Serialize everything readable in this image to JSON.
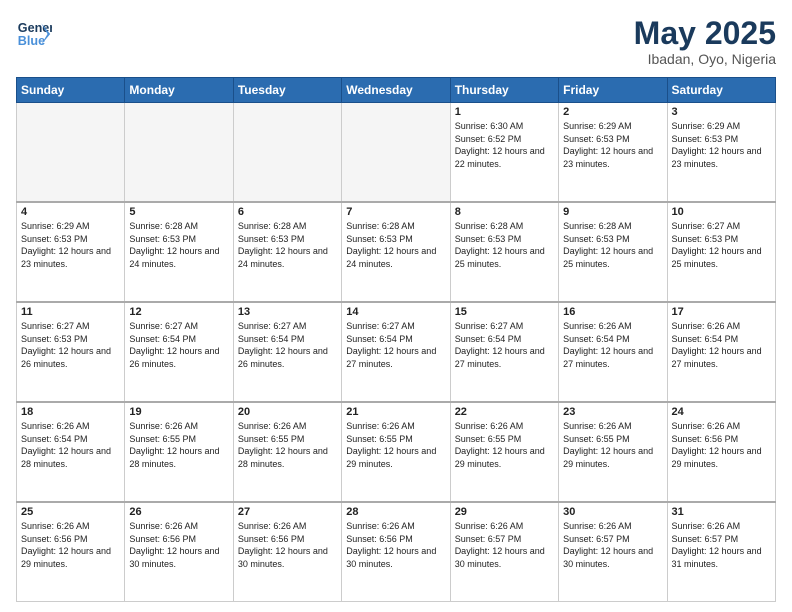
{
  "header": {
    "logo_line1": "General",
    "logo_line2": "Blue",
    "month": "May 2025",
    "location": "Ibadan, Oyo, Nigeria"
  },
  "days_of_week": [
    "Sunday",
    "Monday",
    "Tuesday",
    "Wednesday",
    "Thursday",
    "Friday",
    "Saturday"
  ],
  "weeks": [
    [
      {
        "day": "",
        "empty": true
      },
      {
        "day": "",
        "empty": true
      },
      {
        "day": "",
        "empty": true
      },
      {
        "day": "",
        "empty": true
      },
      {
        "day": "1",
        "sunrise": "6:30 AM",
        "sunset": "6:52 PM",
        "daylight": "12 hours and 22 minutes."
      },
      {
        "day": "2",
        "sunrise": "6:29 AM",
        "sunset": "6:53 PM",
        "daylight": "12 hours and 23 minutes."
      },
      {
        "day": "3",
        "sunrise": "6:29 AM",
        "sunset": "6:53 PM",
        "daylight": "12 hours and 23 minutes."
      }
    ],
    [
      {
        "day": "4",
        "sunrise": "6:29 AM",
        "sunset": "6:53 PM",
        "daylight": "12 hours and 23 minutes."
      },
      {
        "day": "5",
        "sunrise": "6:28 AM",
        "sunset": "6:53 PM",
        "daylight": "12 hours and 24 minutes."
      },
      {
        "day": "6",
        "sunrise": "6:28 AM",
        "sunset": "6:53 PM",
        "daylight": "12 hours and 24 minutes."
      },
      {
        "day": "7",
        "sunrise": "6:28 AM",
        "sunset": "6:53 PM",
        "daylight": "12 hours and 24 minutes."
      },
      {
        "day": "8",
        "sunrise": "6:28 AM",
        "sunset": "6:53 PM",
        "daylight": "12 hours and 25 minutes."
      },
      {
        "day": "9",
        "sunrise": "6:28 AM",
        "sunset": "6:53 PM",
        "daylight": "12 hours and 25 minutes."
      },
      {
        "day": "10",
        "sunrise": "6:27 AM",
        "sunset": "6:53 PM",
        "daylight": "12 hours and 25 minutes."
      }
    ],
    [
      {
        "day": "11",
        "sunrise": "6:27 AM",
        "sunset": "6:53 PM",
        "daylight": "12 hours and 26 minutes."
      },
      {
        "day": "12",
        "sunrise": "6:27 AM",
        "sunset": "6:54 PM",
        "daylight": "12 hours and 26 minutes."
      },
      {
        "day": "13",
        "sunrise": "6:27 AM",
        "sunset": "6:54 PM",
        "daylight": "12 hours and 26 minutes."
      },
      {
        "day": "14",
        "sunrise": "6:27 AM",
        "sunset": "6:54 PM",
        "daylight": "12 hours and 27 minutes."
      },
      {
        "day": "15",
        "sunrise": "6:27 AM",
        "sunset": "6:54 PM",
        "daylight": "12 hours and 27 minutes."
      },
      {
        "day": "16",
        "sunrise": "6:26 AM",
        "sunset": "6:54 PM",
        "daylight": "12 hours and 27 minutes."
      },
      {
        "day": "17",
        "sunrise": "6:26 AM",
        "sunset": "6:54 PM",
        "daylight": "12 hours and 27 minutes."
      }
    ],
    [
      {
        "day": "18",
        "sunrise": "6:26 AM",
        "sunset": "6:54 PM",
        "daylight": "12 hours and 28 minutes."
      },
      {
        "day": "19",
        "sunrise": "6:26 AM",
        "sunset": "6:55 PM",
        "daylight": "12 hours and 28 minutes."
      },
      {
        "day": "20",
        "sunrise": "6:26 AM",
        "sunset": "6:55 PM",
        "daylight": "12 hours and 28 minutes."
      },
      {
        "day": "21",
        "sunrise": "6:26 AM",
        "sunset": "6:55 PM",
        "daylight": "12 hours and 29 minutes."
      },
      {
        "day": "22",
        "sunrise": "6:26 AM",
        "sunset": "6:55 PM",
        "daylight": "12 hours and 29 minutes."
      },
      {
        "day": "23",
        "sunrise": "6:26 AM",
        "sunset": "6:55 PM",
        "daylight": "12 hours and 29 minutes."
      },
      {
        "day": "24",
        "sunrise": "6:26 AM",
        "sunset": "6:56 PM",
        "daylight": "12 hours and 29 minutes."
      }
    ],
    [
      {
        "day": "25",
        "sunrise": "6:26 AM",
        "sunset": "6:56 PM",
        "daylight": "12 hours and 29 minutes."
      },
      {
        "day": "26",
        "sunrise": "6:26 AM",
        "sunset": "6:56 PM",
        "daylight": "12 hours and 30 minutes."
      },
      {
        "day": "27",
        "sunrise": "6:26 AM",
        "sunset": "6:56 PM",
        "daylight": "12 hours and 30 minutes."
      },
      {
        "day": "28",
        "sunrise": "6:26 AM",
        "sunset": "6:56 PM",
        "daylight": "12 hours and 30 minutes."
      },
      {
        "day": "29",
        "sunrise": "6:26 AM",
        "sunset": "6:57 PM",
        "daylight": "12 hours and 30 minutes."
      },
      {
        "day": "30",
        "sunrise": "6:26 AM",
        "sunset": "6:57 PM",
        "daylight": "12 hours and 30 minutes."
      },
      {
        "day": "31",
        "sunrise": "6:26 AM",
        "sunset": "6:57 PM",
        "daylight": "12 hours and 31 minutes."
      }
    ]
  ]
}
